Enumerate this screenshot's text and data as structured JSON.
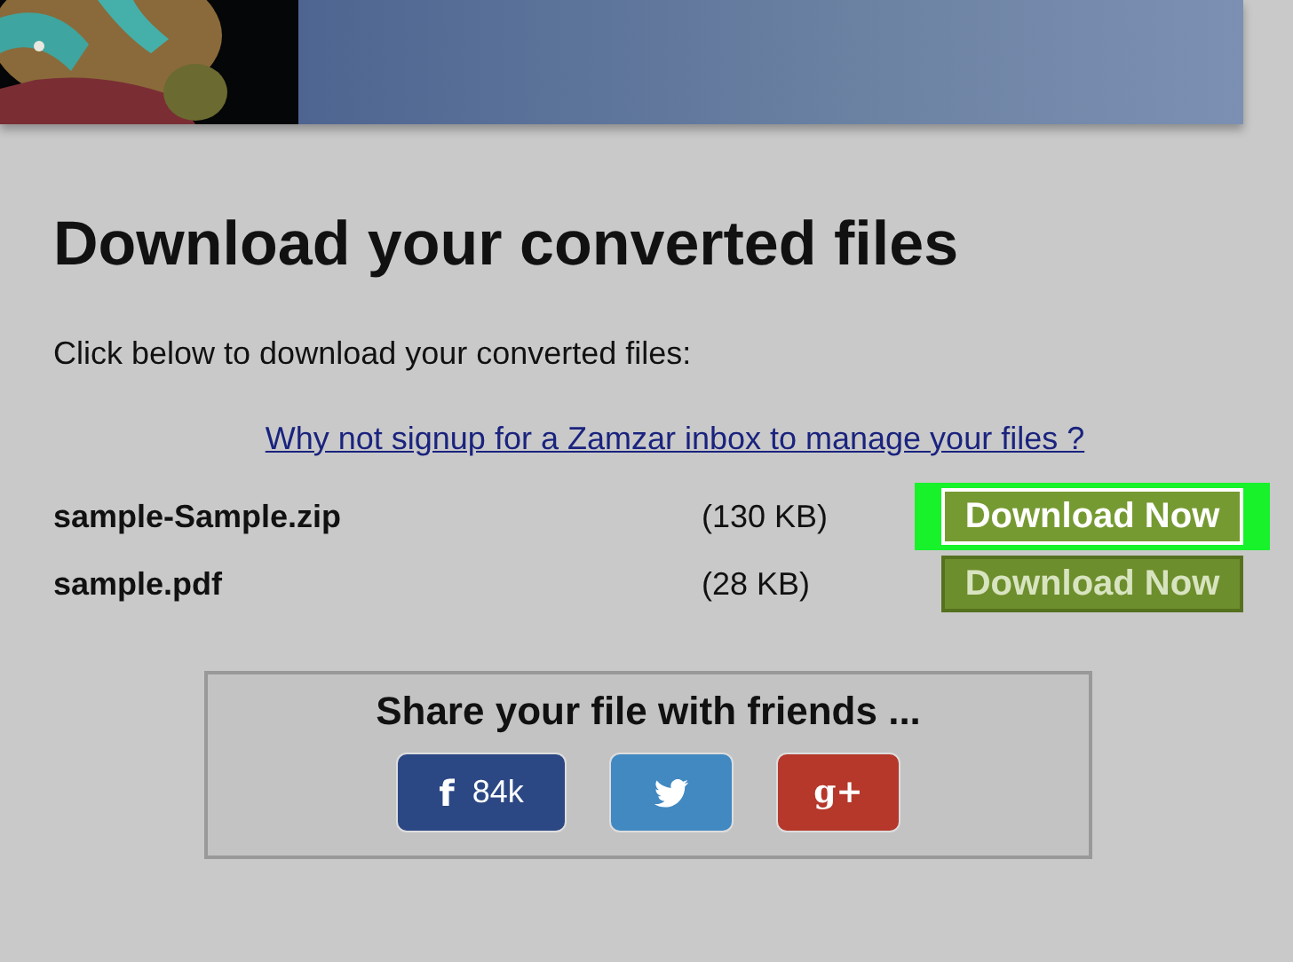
{
  "heading": "Download your converted files",
  "intro": "Click below to download your converted files:",
  "signup_link": "Why not signup for a Zamzar inbox to manage your files ?",
  "files": [
    {
      "name": "sample-Sample.zip",
      "size": "(130 KB)",
      "button": "Download Now",
      "highlighted": true
    },
    {
      "name": "sample.pdf",
      "size": "(28 KB)",
      "button": "Download Now",
      "highlighted": false
    }
  ],
  "share": {
    "title": "Share your file with friends ...",
    "buttons": [
      {
        "kind": "facebook",
        "glyph": "f",
        "count": "84k"
      },
      {
        "kind": "twitter"
      },
      {
        "kind": "googleplus",
        "glyph": "g+"
      }
    ]
  }
}
